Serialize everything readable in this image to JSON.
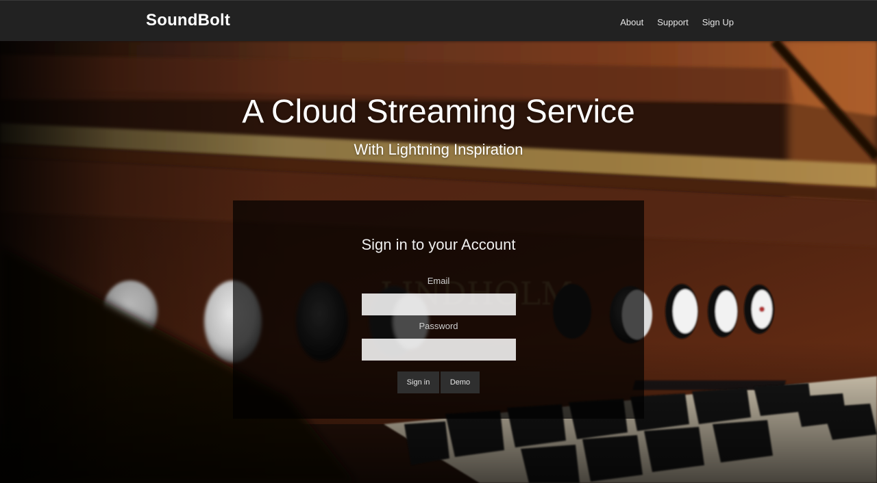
{
  "nav": {
    "brand": "SoundBolt",
    "links": [
      "About",
      "Support",
      "Sign Up"
    ]
  },
  "hero": {
    "title": "A Cloud Streaming Service",
    "subtitle": "With Lightning Inspiration"
  },
  "signin": {
    "heading": "Sign in to your Account",
    "email_label": "Email",
    "email_value": "",
    "password_label": "Password",
    "password_value": "",
    "signin_button": "Sign in",
    "demo_button": "Demo"
  },
  "colors": {
    "navbar_bg": "#222222",
    "panel_bg": "rgba(0,0,0,0.68)",
    "wood_dark": "#3a1a0c",
    "wood_mid": "#6b3318"
  },
  "background": {
    "scene": "blurred reed organ with stop knobs and keyboard"
  }
}
